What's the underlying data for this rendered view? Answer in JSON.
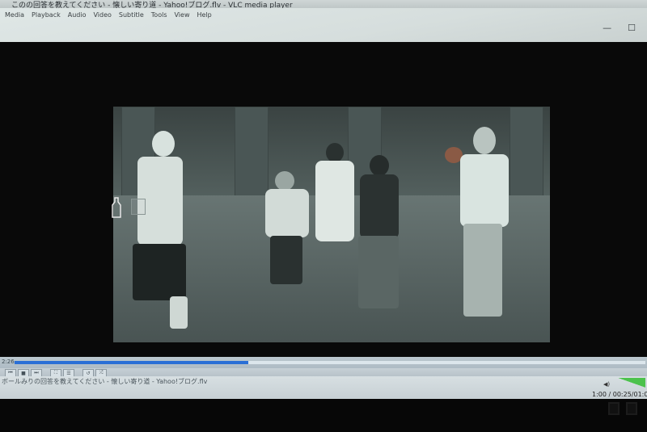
{
  "window": {
    "title": "このの回答を教えてください - 懐しい寄り道 - Yahoo!ブログ.flv - VLC media player",
    "controls": {
      "minimize": "—",
      "maximize": "☐"
    }
  },
  "menu": {
    "items": [
      "Media",
      "Playback",
      "Audio",
      "Video",
      "Subtitle",
      "Tools",
      "View",
      "Help"
    ]
  },
  "player": {
    "seek_time": "2:26",
    "progress_fraction": 0.37,
    "controls": [
      "⏮",
      "■",
      "⏭",
      "⛶",
      "☰",
      "↺",
      "⤮"
    ],
    "status_title": "ボールみりの回答を教えてください - 懐しい寄り道 - Yahoo!ブログ.flv",
    "status_time": "1:00 / 00:25/01:00",
    "volume_icon": "speaker-icon",
    "volume_color": "#4cc24c"
  },
  "colors": {
    "seek_fill": "#2a6fd6",
    "menubar": "#d6dedd"
  }
}
